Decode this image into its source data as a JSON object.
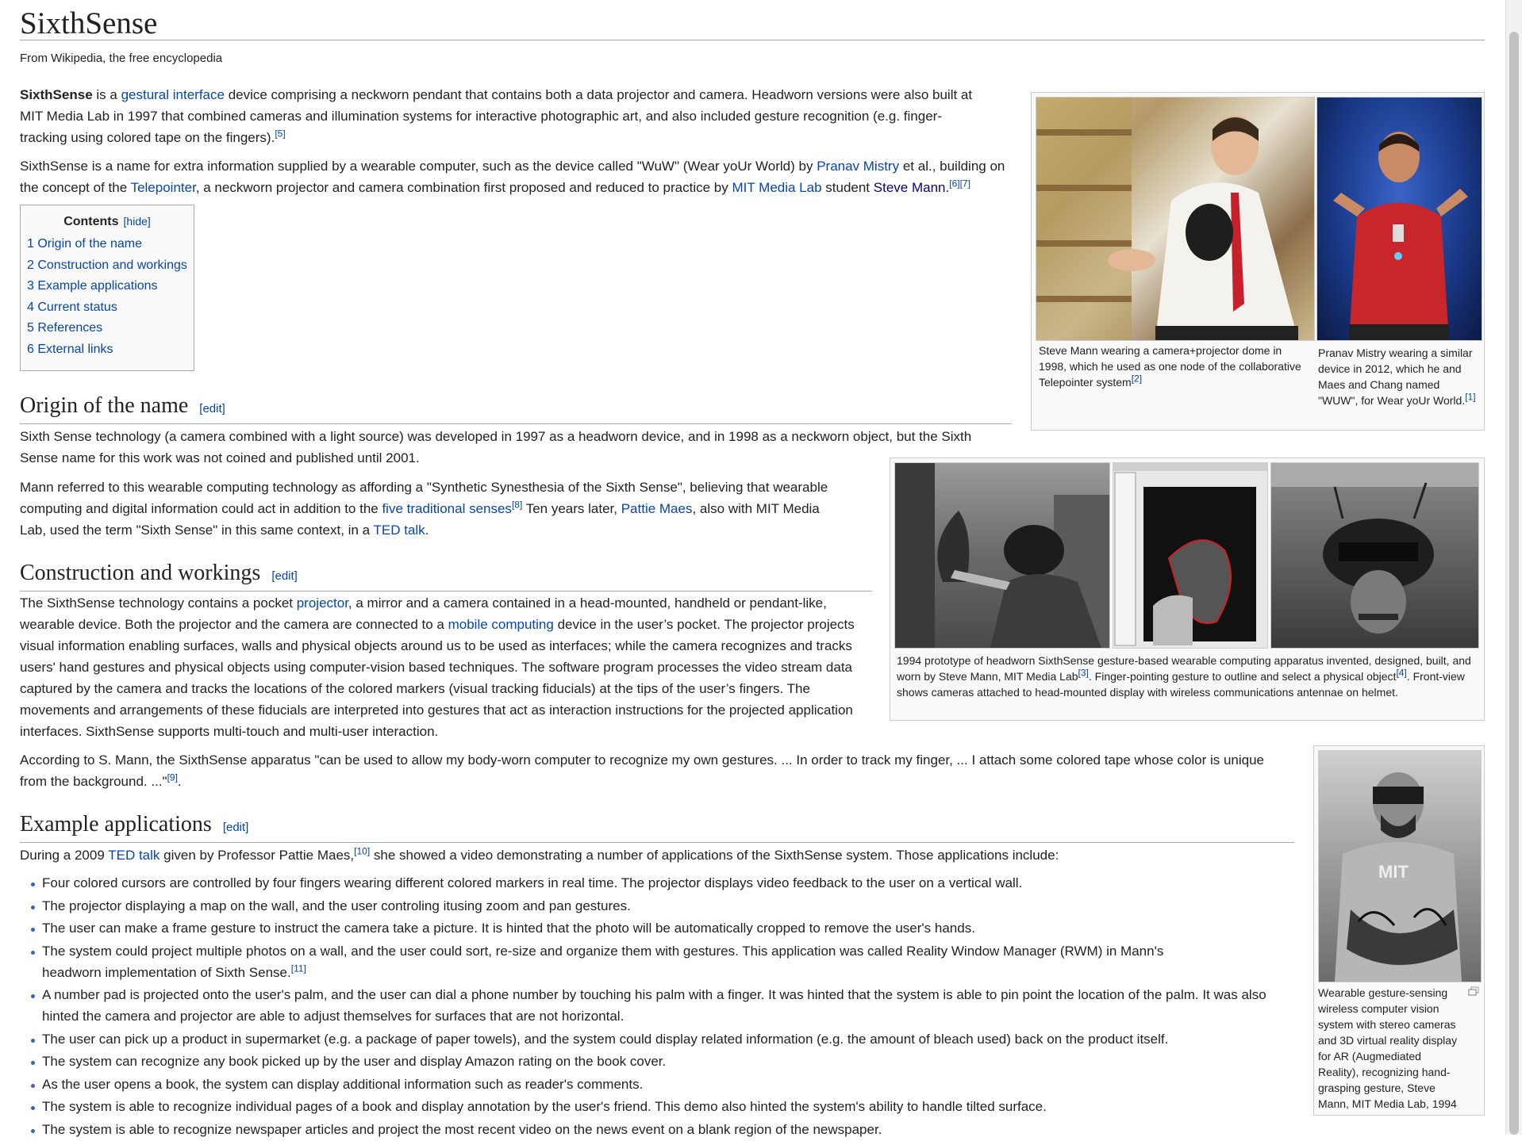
{
  "page": {
    "title": "SixthSense",
    "site_sub": "From Wikipedia, the free encyclopedia"
  },
  "intro": {
    "p1": {
      "bold": "SixthSense",
      "t1": " is a ",
      "link1": "gestural interface",
      "t2": " device comprising a neckworn pendant that contains both a data projector and camera. Headworn versions were also built at MIT Media Lab in 1997 that combined cameras and illumination systems for interactive photographic art, and also included gesture recognition (e.g. finger-tracking using colored tape on the fingers).",
      "ref": "[5]"
    },
    "p2": {
      "t1": "SixthSense is a name for extra information supplied by a wearable computer, such as the device called \"WuW\" (Wear yoUr World) by ",
      "link1": "Pranav Mistry",
      "t2": " et al., building on the concept of the ",
      "link2": "Telepointer",
      "t3": ", a neckworn projector and camera combination first proposed and reduced to practice by ",
      "link3": "MIT Media Lab",
      "t4": " student ",
      "link4": "Steve Mann",
      "t5": ".",
      "ref1": "[6]",
      "ref2": "[7]"
    }
  },
  "toc": {
    "title": "Contents",
    "hide": "[hide]",
    "items": [
      "1 Origin of the name",
      "2 Construction and workings",
      "3 Example applications",
      "4 Current status",
      "5 References",
      "6 External links"
    ]
  },
  "sections": {
    "origin": {
      "heading": "Origin of the name",
      "edit": "[edit]",
      "p1": "Sixth Sense technology (a camera combined with a light source) was developed in 1997 as a headworn device, and in 1998 as a neckworn object, but the Sixth Sense name for this work was not coined and published until 2001.",
      "p2": {
        "t1": "Mann referred to this wearable computing technology as affording a \"Synthetic Synesthesia of the Sixth Sense\", believing that wearable computing and digital information could act in addition to the ",
        "link1": "five traditional senses",
        "ref1": "[8]",
        "t2": " Ten years later, ",
        "link2": "Pattie Maes",
        "t3": ", also with MIT Media Lab, used the term \"Sixth Sense\" in this same context, in a ",
        "link3": "TED talk",
        "t4": "."
      }
    },
    "construction": {
      "heading": "Construction and workings",
      "edit": "[edit]",
      "p1": {
        "t1": "The SixthSense technology contains a pocket ",
        "link1": "projector",
        "t2": ", a mirror and a camera contained in a head-mounted, handheld or pendant-like, wearable device. Both the projector and the camera are connected to a ",
        "link2": "mobile computing",
        "t3": " device in the user’s pocket. The projector projects visual information enabling surfaces, walls and physical objects around us to be used as interfaces; while the camera recognizes and tracks users' hand gestures and physical objects using computer-vision based techniques. The software program processes the video stream data captured by the camera and tracks the locations of the colored markers (visual tracking fiducials) at the tips of the user’s fingers. The movements and arrangements of these fiducials are interpreted into gestures that act as interaction instructions for the projected application interfaces. SixthSense supports multi-touch and multi-user interaction."
      },
      "p2": {
        "t1": "According to S. Mann, the SixthSense apparatus \"can be used to allow my body-worn computer to recognize my own gestures. ... In order to track my finger, ... I attach some colored tape whose color is unique from the background. ...\"",
        "ref1": "[9]",
        "t2": "."
      }
    },
    "examples": {
      "heading": "Example applications",
      "edit": "[edit]",
      "p1": {
        "t1": "During a 2009 ",
        "link1": "TED talk",
        "t2": " given by Professor Pattie Maes,",
        "ref1": "[10]",
        "t3": " she showed a video demonstrating a number of applications of the SixthSense system. Those applications include:"
      },
      "items": [
        {
          "text": "Four colored cursors are controlled by four fingers wearing different colored markers in real time. The projector displays video feedback to the user on a vertical wall.",
          "ref": ""
        },
        {
          "text": "The projector displaying a map on the wall, and the user controling itusing zoom and pan gestures.",
          "ref": ""
        },
        {
          "text": "The user can make a frame gesture to instruct the camera take a picture. It is hinted that the photo will be automatically cropped to remove the user's hands.",
          "ref": ""
        },
        {
          "text": "The system could project multiple photos on a wall, and the user could sort, re-size and organize them with gestures. This application was called Reality Window Manager (RWM) in Mann's headworn implementation of Sixth Sense.",
          "ref": "[11]"
        },
        {
          "text": "A number pad is projected onto the user's palm, and the user can dial a phone number by touching his palm with a finger. It was hinted that the system is able to pin point the location of the palm. It was also hinted the camera and projector are able to adjust themselves for surfaces that are not horizontal.",
          "ref": ""
        },
        {
          "text": "The user can pick up a product in supermarket (e.g. a package of paper towels), and the system could display related information (e.g. the amount of bleach used) back on the product itself.",
          "ref": ""
        },
        {
          "text": "The system can recognize any book picked up by the user and display Amazon rating on the book cover.",
          "ref": ""
        },
        {
          "text": "As the user opens a book, the system can display additional information such as reader's comments.",
          "ref": ""
        },
        {
          "text": "The system is able to recognize individual pages of a book and display annotation by the user's friend. This demo also hinted the system's ability to handle tilted surface.",
          "ref": ""
        },
        {
          "text": "The system is able to recognize newspaper articles and project the most recent video on the news event on a blank region of the newspaper.",
          "ref": ""
        }
      ]
    }
  },
  "images": {
    "mann_caption": "Steve Mann wearing a camera+projector dome in 1998, which he used as one node of the collaborative Telepointer system",
    "mann_ref": "[2]",
    "mistry_caption": "Pranav Mistry wearing a similar device in 2012, which he and Maes and Chang named \"WUW\", for Wear yoUr World.",
    "mistry_ref": "[1]",
    "proto_caption_t1": "1994 prototype of headworn SixthSense gesture-based wearable computing apparatus invented, designed, built, and worn by Steve Mann, MIT Media Lab",
    "proto_ref1": "[3]",
    "proto_caption_t2": ". Finger-pointing gesture to outline and select a physical object",
    "proto_ref2": "[4]",
    "proto_caption_t3": ". Front-view shows cameras attached to head-mounted display with wireless communications antennae on helmet.",
    "mit_caption": "Wearable gesture-sensing wireless computer vision system with stereo cameras and 3D virtual reality display for AR (Augmediated Reality), recognizing hand-grasping gesture, Steve Mann, MIT Media Lab, 1994"
  },
  "icons": {
    "enlarge": "enlarge-icon"
  }
}
